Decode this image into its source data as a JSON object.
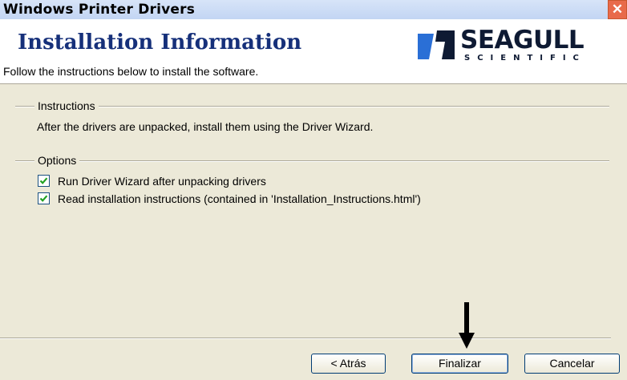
{
  "window": {
    "title": "Windows Printer Drivers",
    "close_label": "✕"
  },
  "header": {
    "title": "Installation Information",
    "subtitle": "Follow the instructions below to install the software.",
    "logo": {
      "name": "SEAGULL",
      "sub": "SCIENTIFIC",
      "brand_color": "#0e1a33",
      "mark_color": "#2a6fd6"
    }
  },
  "instructions": {
    "label": "Instructions",
    "text": "After the drivers are unpacked, install them using the Driver Wizard."
  },
  "options": {
    "label": "Options",
    "items": [
      {
        "label": "Run Driver Wizard after unpacking drivers",
        "checked": true
      },
      {
        "label": "Read installation instructions (contained in 'Installation_Instructions.html')",
        "checked": true
      }
    ]
  },
  "buttons": {
    "back": "< Atrás",
    "finish": "Finalizar",
    "cancel": "Cancelar"
  },
  "colors": {
    "title_color": "#16307a",
    "check_color": "#21a121"
  }
}
